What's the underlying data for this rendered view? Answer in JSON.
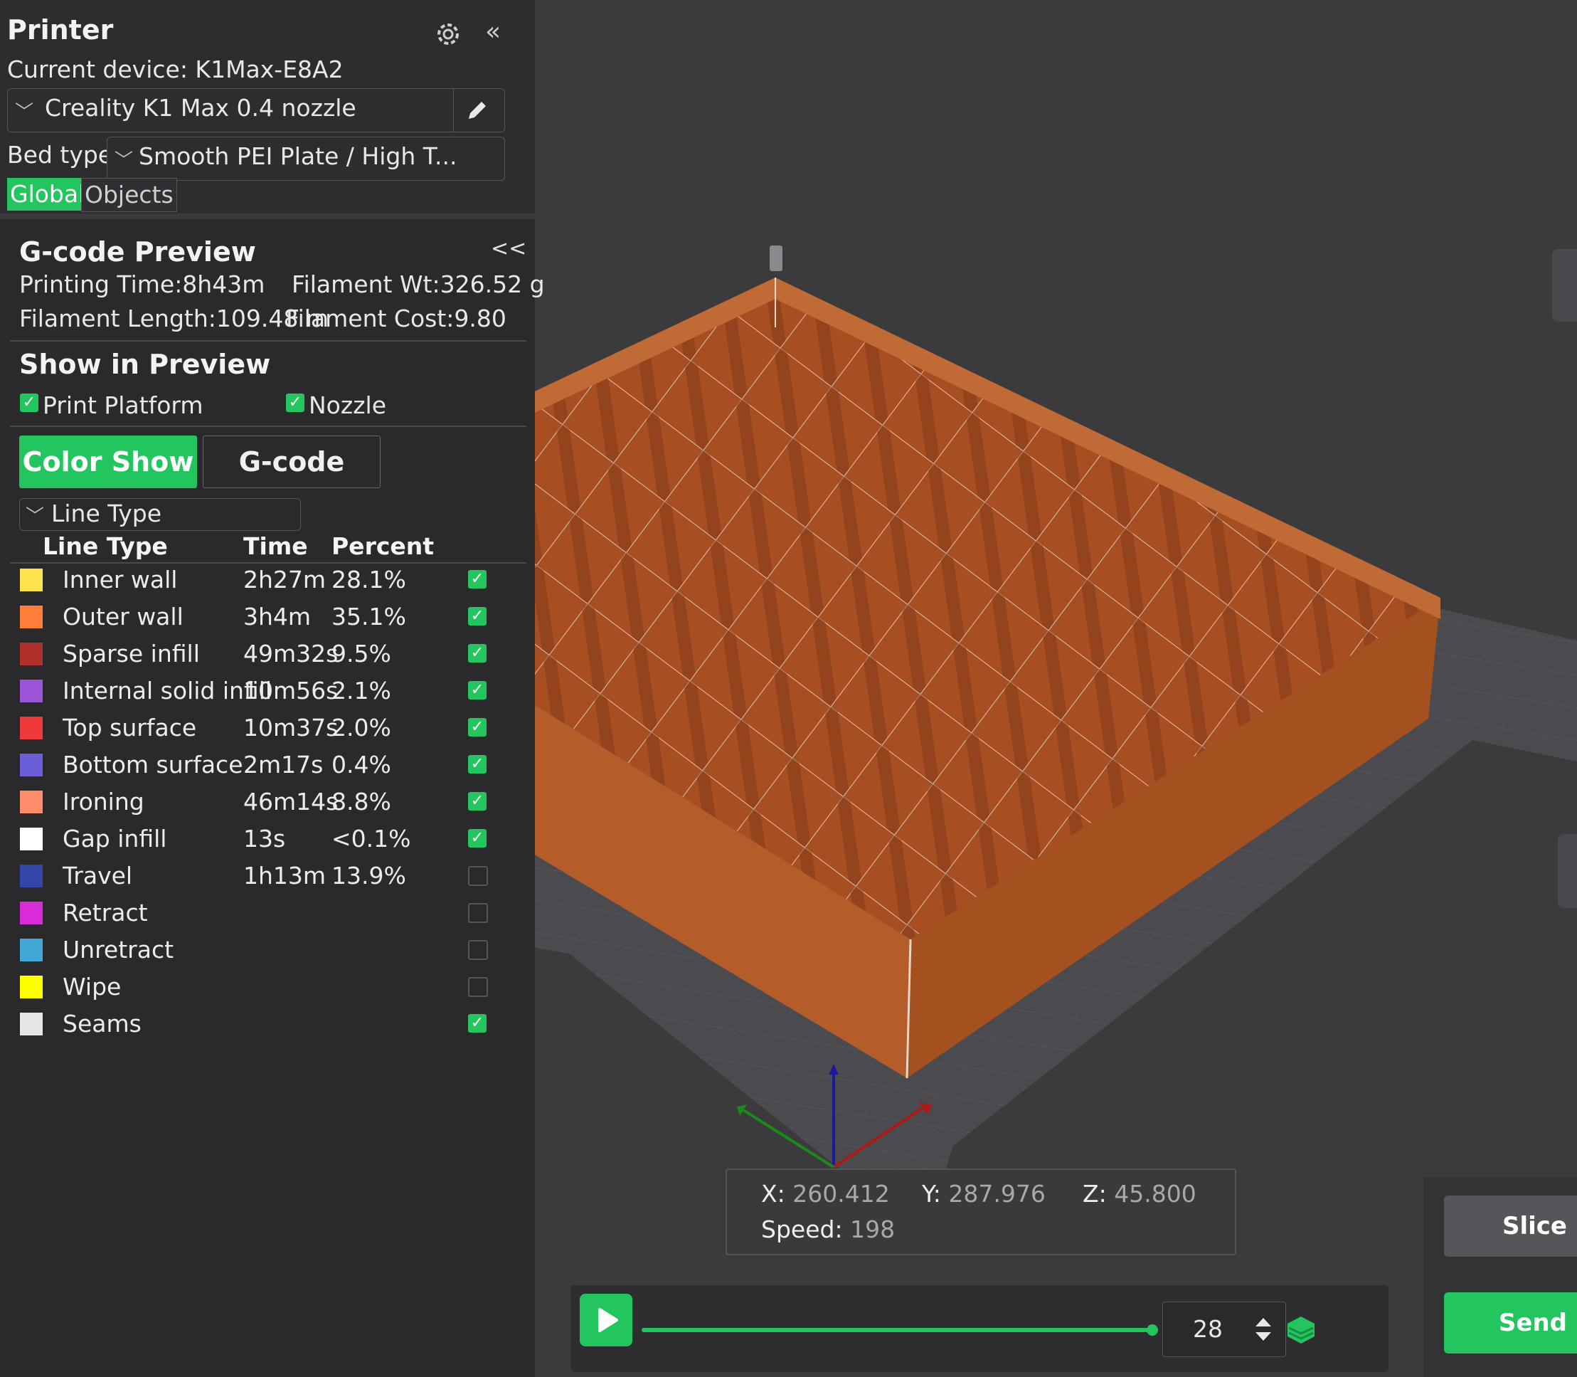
{
  "printer": {
    "title": "Printer",
    "current_device": "Current device: K1Max-E8A2",
    "profile": "Creality K1 Max 0.4 nozzle",
    "bed_type_label": "Bed type",
    "bed_type_value": "Smooth PEI Plate / High T...",
    "tabs": [
      {
        "label": "Global",
        "active": true
      },
      {
        "label": "Objects",
        "active": false
      }
    ],
    "collapse_label": "«"
  },
  "preview": {
    "title": "G-code Preview",
    "collapse_label": "<<",
    "printing_time": "Printing Time:8h43m",
    "filament_wt": "Filament Wt:326.52 g",
    "filament_length": "Filament Length:109.48 m",
    "filament_cost": "Filament Cost:9.80",
    "show_title": "Show in Preview",
    "opt_platform": "Print Platform",
    "opt_nozzle": "Nozzle",
    "btn_color_show": "Color Show",
    "btn_gcode": "G-code",
    "view_select": "Line Type",
    "col_type": "Line Type",
    "col_time": "Time",
    "col_percent": "Percent",
    "rows": [
      {
        "label": "Inner wall",
        "time": "2h27m",
        "percent": "28.1%",
        "color": "#ffe14d",
        "checked": true
      },
      {
        "label": "Outer wall",
        "time": "3h4m",
        "percent": "35.1%",
        "color": "#ff7d38",
        "checked": true
      },
      {
        "label": "Sparse infill",
        "time": "49m32s",
        "percent": "9.5%",
        "color": "#b0302c",
        "checked": true
      },
      {
        "label": "Internal solid infill",
        "time": "10m56s",
        "percent": "2.1%",
        "color": "#9a55d8",
        "checked": true
      },
      {
        "label": "Top surface",
        "time": "10m37s",
        "percent": "2.0%",
        "color": "#f03a3a",
        "checked": true
      },
      {
        "label": "Bottom surface",
        "time": "2m17s",
        "percent": "0.4%",
        "color": "#6a5fd6",
        "checked": true
      },
      {
        "label": "Ironing",
        "time": "46m14s",
        "percent": "8.8%",
        "color": "#ff8c6a",
        "checked": true
      },
      {
        "label": "Gap infill",
        "time": "13s",
        "percent": "<0.1%",
        "color": "#ffffff",
        "checked": true
      },
      {
        "label": "Travel",
        "time": "1h13m",
        "percent": "13.9%",
        "color": "#3447a8",
        "checked": false
      },
      {
        "label": "Retract",
        "time": "",
        "percent": "",
        "color": "#d82cd8",
        "checked": false
      },
      {
        "label": "Unretract",
        "time": "",
        "percent": "",
        "color": "#42a8d8",
        "checked": false
      },
      {
        "label": "Wipe",
        "time": "",
        "percent": "",
        "color": "#ffff00",
        "checked": false
      },
      {
        "label": "Seams",
        "time": "",
        "percent": "",
        "color": "#e6e6e6",
        "checked": true
      }
    ]
  },
  "coords": {
    "x_label": "X:",
    "x_value": "260.412",
    "y_label": "Y:",
    "y_value": "287.976",
    "z_label": "Z:",
    "z_value": "45.800",
    "speed_label": "Speed:",
    "speed_value": "198"
  },
  "playback": {
    "layer": "28",
    "progress": 1.0
  },
  "actions": {
    "slice": "Slice",
    "send": "Send"
  },
  "colors": {
    "accent": "#22c55e",
    "model": "#b35a2a"
  },
  "icons": [
    "gear-icon",
    "edit-icon",
    "chevron-down-icon",
    "play-icon",
    "layer-updown-icon",
    "layers-icon"
  ]
}
